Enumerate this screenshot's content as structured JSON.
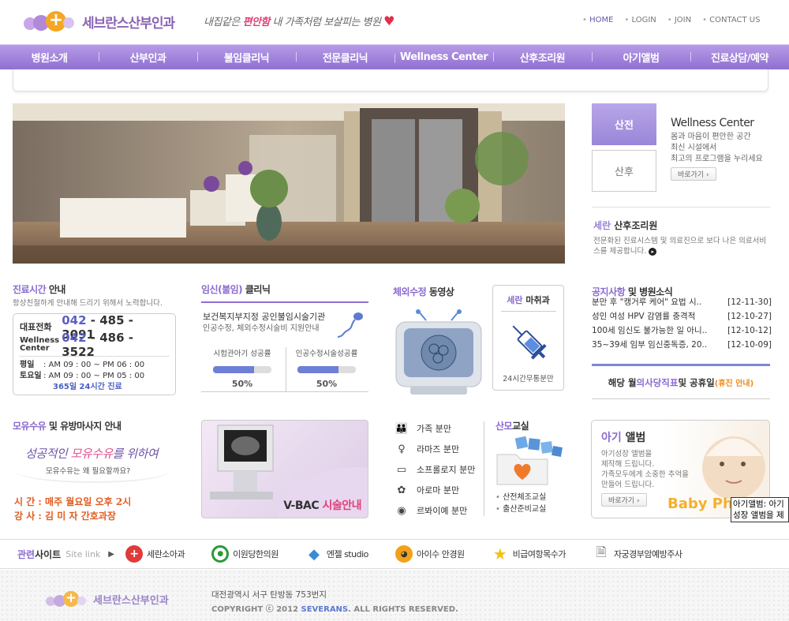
{
  "header": {
    "logo_text": "세브란스산부인과",
    "slogan_pre": "내집같은 ",
    "slogan_highlight": "편안함",
    "slogan_post": " 내 가족처럼 보살피는 병원",
    "links": [
      "HOME",
      "LOGIN",
      "JOIN",
      "CONTACT US"
    ]
  },
  "nav": [
    "병원소개",
    "산부인과",
    "불임클리닉",
    "전문클리닉",
    "Wellness Center",
    "산후조리원",
    "아기앨범",
    "진료상담/예약"
  ],
  "wellness": {
    "tab_active": "산전",
    "tab_inactive": "산후",
    "title": "Wellness Center",
    "desc": "몸과 마음이 편안한 공간\n최신 시설에서\n최고의 프로그램을 누리세요",
    "button": "바로가기"
  },
  "postpartum": {
    "brand": "세란",
    "title": " 산후조리원",
    "desc": "전문화된 진료시스템 및 의료진으로 보다 나은 의료서비스를 제공합니다."
  },
  "hours": {
    "title_color": "진료시간",
    "title": " 안내",
    "sub": "항상친절하게 안내해 드리기 위해서 노력합니다.",
    "tel1_label": "대표전화",
    "tel1_prefix": "042",
    "tel1_rest": " - 485 - 3091",
    "tel2_label": "Wellness Center",
    "tel2_prefix": "042",
    "tel2_rest": " - 486 - 3522",
    "weekday_label": "평일",
    "weekday": ": AM 09 : 00 ~ PM 06 : 00",
    "sat_label": "토요일",
    "sat": ": AM 09 : 00 ~ PM 05 : 00",
    "allday": "365일 24시간 진료"
  },
  "ivf": {
    "title_color": "임신(불임)",
    "title": " 클리닉",
    "line1": "보건복지부지정 공인불임시술기관",
    "line2": "인공수정, 체외수정시술비 지원안내",
    "stats": [
      {
        "label": "시험관아기 성공률",
        "value": "50%",
        "fill": 0.7
      },
      {
        "label": "인공수정시술성공률",
        "value": "50%",
        "fill": 0.7
      }
    ]
  },
  "video": {
    "title_color": "체외수정",
    "title": " 동영상"
  },
  "mahui": {
    "brand": "세란",
    "title": " 마취과",
    "desc": "24시간무통분만"
  },
  "notices": {
    "title_color": "공지사항",
    "title": " 및 병원소식",
    "items": [
      {
        "title": "분만 후 \"캥거루 케어\" 요법 시..",
        "date": "[12-11-30]"
      },
      {
        "title": "성인 여성 HPV 감염률 충격적",
        "date": "[12-10-27]"
      },
      {
        "title": "100세 임신도 불가능한 일 아니..",
        "date": "[12-10-12]"
      },
      {
        "title": "35~39세 임부 임신중독증, 20..",
        "date": "[12-10-09]"
      }
    ],
    "duty_pre": "해당 월 ",
    "duty_color": "의사당직표",
    "duty_post": " 및 공휴일 ",
    "duty_orange": "(휴진 안내)"
  },
  "breastfeeding": {
    "title_color": "모유수유",
    "title": " 및 유방마사지 안내",
    "hand_pre": "성공적인 ",
    "hand_highlight": "모유수유",
    "hand_post": "를 위하여",
    "sub": "모유수유는 왜 필요할까요?",
    "time": "시 간 : 매주 월요일 오후 2시",
    "teacher": "강 사 : 김 미 자 간호과장"
  },
  "vbac": {
    "label_pre": "V-BAC ",
    "label_color": "시술안내"
  },
  "deliveries": [
    {
      "icon": "family-icon",
      "label": "가족 분만"
    },
    {
      "icon": "person-icon",
      "label": "라마즈 분만"
    },
    {
      "icon": "monitor-icon",
      "label": "소프롤로지 분만"
    },
    {
      "icon": "flower-icon",
      "label": "아로마 분만"
    },
    {
      "icon": "eye-icon",
      "label": "르봐이예 분만"
    }
  ],
  "sanmo": {
    "title_color": "산모",
    "title": "교실",
    "items": [
      "산전체조교실",
      "출산준비교실"
    ]
  },
  "album": {
    "title_color": "아기",
    "title": " 앨범",
    "desc": "아기성장 앨범을\n제작해 드립니다.\n가족모두에게 소중한 추억을\n만들어 드립니다.",
    "button": "바로가기",
    "baby_photo": "Baby Photo",
    "tooltip": "아기앨범: 아기성장 앨범을 제작해 드립니다. 가족모두에게 소중한 추억을"
  },
  "related": {
    "label_color": "관련",
    "label": "사이트",
    "site_link": "Site link",
    "links": [
      {
        "icon": "red-cross-icon",
        "label": "세란소아과"
      },
      {
        "icon": "green-circle-icon",
        "label": "이원당한의원"
      },
      {
        "icon": "studio-icon",
        "label": "엔젤 studio"
      },
      {
        "icon": "eye-clinic-icon",
        "label": "아이수 안경원"
      },
      {
        "icon": "star-icon",
        "label": "비급여항목수가"
      },
      {
        "icon": "document-icon",
        "label": "자궁경부암예방주사"
      }
    ]
  },
  "footer": {
    "logo_text": "세브란스산부인과",
    "address": "대전광역시 서구 탄방동 753번지",
    "copy_pre": "COPYRIGHT ⓒ 2012 ",
    "copy_brand": "SEVERANS",
    "copy_post": ". ALL RIGHTS RESERVED."
  },
  "colors": {
    "brand": "#8f6fd1",
    "accent": "#e0407a",
    "blue": "#5b5fc4"
  }
}
